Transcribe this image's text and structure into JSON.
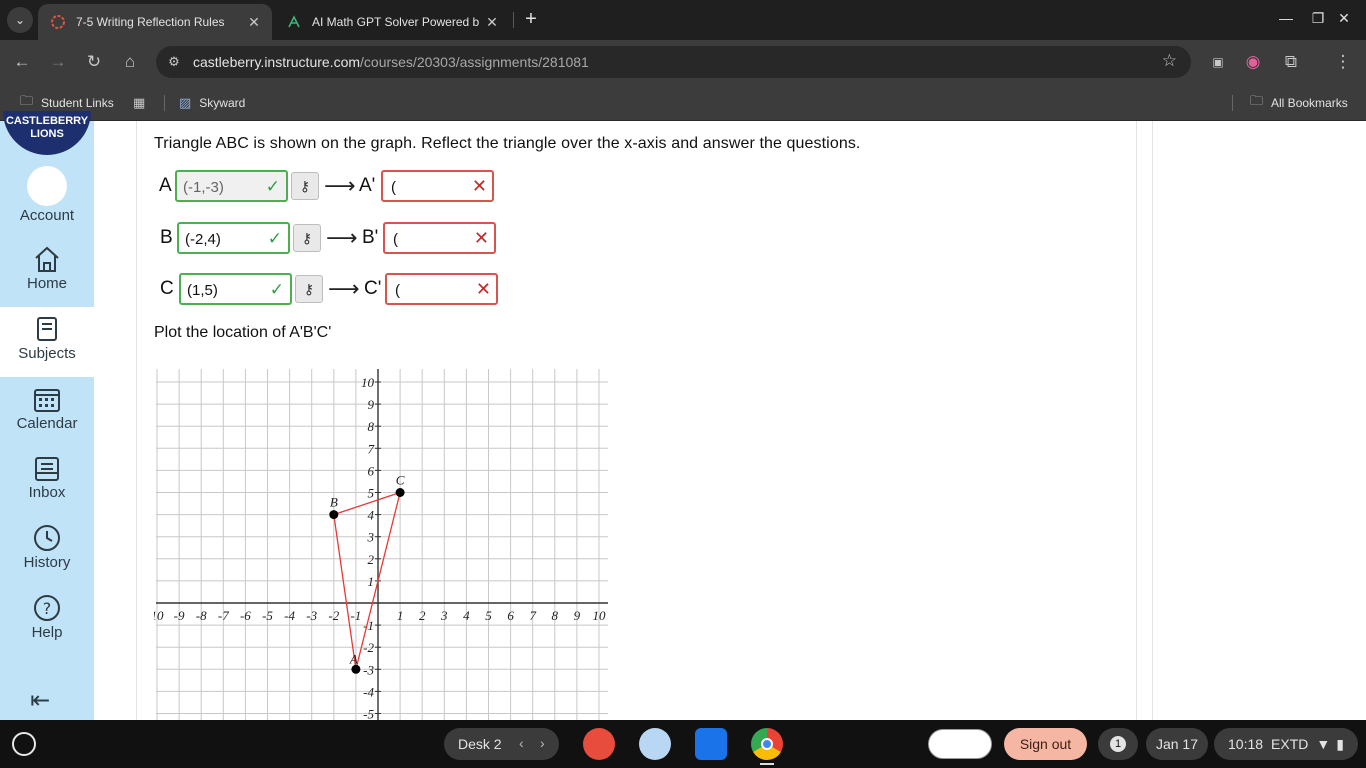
{
  "browser": {
    "tabs": [
      {
        "title": "7-5 Writing Reflection Rules",
        "icon": "canvas-icon",
        "active": true
      },
      {
        "title": "AI Math GPT Solver Powered b",
        "icon": "math-gpt-icon",
        "active": false
      }
    ],
    "url_host": "castleberry.instructure.com",
    "url_path": "/courses/20303/assignments/281081",
    "bookmarks": [
      {
        "label": "Student Links",
        "icon": "folder-icon"
      },
      {
        "label": "Skyward",
        "icon": "skyward-icon"
      }
    ],
    "all_bookmarks": "All Bookmarks"
  },
  "sidebar": {
    "logo_text": "CASTLEBERRY LIONS",
    "items": [
      {
        "label": "Account",
        "icon": "account-icon"
      },
      {
        "label": "Home",
        "icon": "home-icon"
      },
      {
        "label": "Subjects",
        "icon": "subjects-icon"
      },
      {
        "label": "Calendar",
        "icon": "calendar-icon"
      },
      {
        "label": "Inbox",
        "icon": "inbox-icon"
      },
      {
        "label": "History",
        "icon": "history-icon"
      },
      {
        "label": "Help",
        "icon": "help-icon"
      }
    ]
  },
  "question": {
    "prompt": "Triangle ABC is shown on the graph. Reflect the triangle over the x-axis and answer the questions.",
    "rows": [
      {
        "label": "A",
        "value": "(-1,-3)",
        "image_label": "A'",
        "image_value": "("
      },
      {
        "label": "B",
        "value": "(-2,4)",
        "image_label": "B'",
        "image_value": "("
      },
      {
        "label": "C",
        "value": "(1,5)",
        "image_label": "C'",
        "image_value": "("
      }
    ],
    "plot_prompt": "Plot the location of A'B'C'"
  },
  "chart_data": {
    "type": "scatter",
    "x_range": [
      -10,
      10
    ],
    "y_range": [
      -5,
      10
    ],
    "grid": true,
    "x_ticks": [
      "10",
      "-9",
      "-8",
      "-7",
      "-6",
      "-5",
      "-4",
      "-3",
      "-2",
      "-1",
      "1",
      "2",
      "3",
      "4",
      "5",
      "6",
      "7",
      "8",
      "9",
      "10"
    ],
    "y_ticks": [
      "10",
      "9",
      "8",
      "7",
      "6",
      "5",
      "4",
      "3",
      "2",
      "1",
      "-1",
      "-2",
      "-3",
      "-4",
      "-5"
    ],
    "points": [
      {
        "label": "A",
        "x": -1,
        "y": -3
      },
      {
        "label": "B",
        "x": -2,
        "y": 4
      },
      {
        "label": "C",
        "x": 1,
        "y": 5
      }
    ],
    "polygon_color": "#e53935"
  },
  "shelf": {
    "desk": "Desk 2",
    "sign_out": "Sign out",
    "notifications": "1",
    "date": "Jan 17",
    "time": "10:18",
    "extd": "EXTD"
  }
}
